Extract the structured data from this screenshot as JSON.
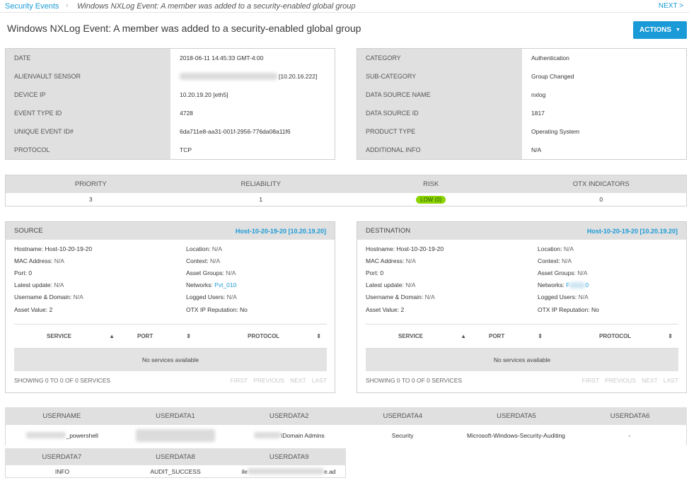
{
  "breadcrumb": {
    "root": "Security Events",
    "current": "Windows NXLog Event: A member was added to a security-enabled global group"
  },
  "nav": {
    "next": "NEXT >"
  },
  "title": "Windows NXLog Event: A member was added to a security-enabled global group",
  "actions_label": "ACTIONS",
  "details_left": [
    {
      "label": "DATE",
      "value": "2018-06-11 14:45:33 GMT-4:00"
    },
    {
      "label": "ALIENVAULT SENSOR",
      "value": "[10.20.16.222]"
    },
    {
      "label": "DEVICE IP",
      "value": "10.20.19.20 [eth5]"
    },
    {
      "label": "EVENT TYPE ID",
      "value": "4728"
    },
    {
      "label": "UNIQUE EVENT ID#",
      "value": "6da711e8-aa31-001f-2956-776da08a11f6"
    },
    {
      "label": "PROTOCOL",
      "value": "TCP"
    }
  ],
  "details_right": [
    {
      "label": "CATEGORY",
      "value": "Authentication"
    },
    {
      "label": "SUB-CATEGORY",
      "value": "Group Changed"
    },
    {
      "label": "DATA SOURCE NAME",
      "value": "nxlog"
    },
    {
      "label": "DATA SOURCE ID",
      "value": "1817"
    },
    {
      "label": "PRODUCT TYPE",
      "value": "Operating System"
    },
    {
      "label": "ADDITIONAL INFO",
      "value": "N/A"
    }
  ],
  "stats": {
    "priority_label": "PRIORITY",
    "priority": "3",
    "reliability_label": "RELIABILITY",
    "reliability": "1",
    "risk_label": "RISK",
    "risk": "LOW (0)",
    "otx_label": "OTX INDICATORS",
    "otx": "0"
  },
  "source": {
    "title": "SOURCE",
    "host": "Host-10-20-19-20 [10.20.19.20]",
    "hostname_label": "Hostname:",
    "hostname": "Host-10-20-19-20",
    "mac_label": "MAC Address:",
    "mac": "N/A",
    "port_label": "Port:",
    "port": "0",
    "latest_label": "Latest update:",
    "latest": "N/A",
    "user_label": "Username & Domain:",
    "user": "N/A",
    "asset_label": "Asset Value:",
    "asset": "2",
    "location_label": "Location:",
    "location": "N/A",
    "context_label": "Context:",
    "context": "N/A",
    "groups_label": "Asset Groups:",
    "groups": "N/A",
    "networks_label": "Networks:",
    "networks": "Pvt_010",
    "logged_label": "Logged Users:",
    "logged": "N/A",
    "otx_label": "OTX IP Reputation:",
    "otx": "No"
  },
  "destination": {
    "title": "DESTINATION",
    "host": "Host-10-20-19-20 [10.20.19.20]",
    "hostname_label": "Hostname:",
    "hostname": "Host-10-20-19-20",
    "mac_label": "MAC Address:",
    "mac": "N/A",
    "port_label": "Port:",
    "port": "0",
    "latest_label": "Latest update:",
    "latest": "N/A",
    "user_label": "Username & Domain:",
    "user": "N/A",
    "asset_label": "Asset Value:",
    "asset": "2",
    "location_label": "Location:",
    "location": "N/A",
    "context_label": "Context:",
    "context": "N/A",
    "groups_label": "Asset Groups:",
    "groups": "N/A",
    "networks_label": "Networks:",
    "networks_prefix": "F",
    "networks_suffix": "0",
    "logged_label": "Logged Users:",
    "logged": "N/A",
    "otx_label": "OTX IP Reputation:",
    "otx": "No"
  },
  "services": {
    "col_service": "SERVICE",
    "col_port": "PORT",
    "col_protocol": "PROTOCOL",
    "empty": "No services available",
    "showing": "SHOWING 0 TO 0 OF 0 SERVICES",
    "first": "FIRST",
    "previous": "PREVIOUS",
    "next": "NEXT",
    "last": "LAST"
  },
  "userdata": {
    "headers1": [
      "USERNAME",
      "USERDATA1",
      "USERDATA2",
      "USERDATA4",
      "USERDATA5",
      "USERDATA6"
    ],
    "username_suffix": "_powershell",
    "userdata2_suffix": "\\Domain Admins",
    "userdata4": "Security",
    "userdata5": "Microsoft-Windows-Security-Auditing",
    "userdata6": "-",
    "headers2": [
      "USERDATA7",
      "USERDATA8",
      "USERDATA9"
    ],
    "userdata7": "INFO",
    "userdata8": "AUDIT_SUCCESS",
    "userdata9_prefix": "ile",
    "userdata9_suffix": "e.ad"
  },
  "colors": {
    "accent": "#1a9ad6",
    "header_bg": "#e0e0e0",
    "risk_low": "#8cd400"
  }
}
